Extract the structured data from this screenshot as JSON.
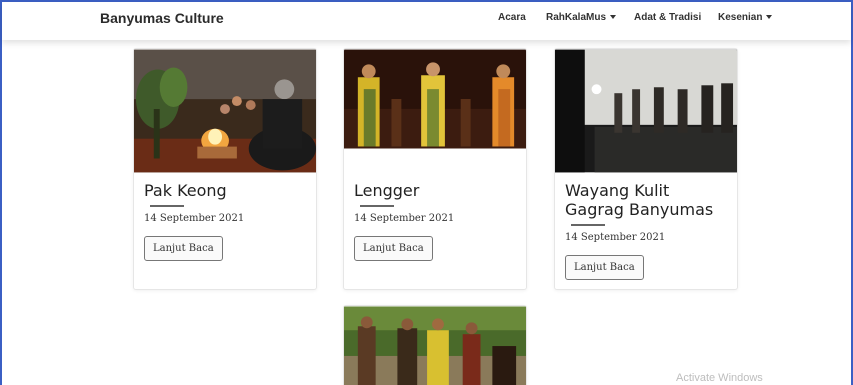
{
  "brand": "Banyumas Culture",
  "nav": {
    "acara": "Acara",
    "rahkalamus": "RahKalaMus",
    "adat": "Adat & Tradisi",
    "kesenian": "Kesenian"
  },
  "cards": [
    {
      "title": "Pak Keong",
      "date": "14 September 2021",
      "button": "Lanjut Baca"
    },
    {
      "title": "Lengger",
      "date": "14 September 2021",
      "button": "Lanjut Baca"
    },
    {
      "title": "Wayang Kulit Gagrag Banyumas",
      "date": "14 September 2021",
      "button": "Lanjut Baca"
    }
  ],
  "watermark": "Activate Windows",
  "colors": {
    "frame": "#3b5fc4"
  }
}
